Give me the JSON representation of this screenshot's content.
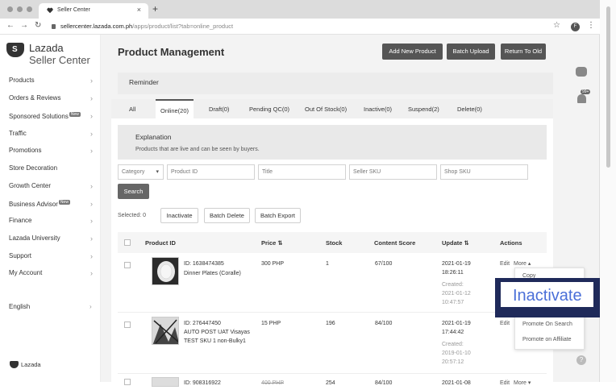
{
  "browser": {
    "tab_title": "Seller Center",
    "tab_close": "×",
    "new_tab": "+",
    "back": "←",
    "forward": "→",
    "reload": "↻",
    "url_host": "sellercenter.lazada.com.ph",
    "url_path": "/apps/product/list?tab=online_product",
    "star": "☆",
    "profile": "F",
    "menu": "⋮"
  },
  "sidebar": {
    "brand": "Lazada",
    "subtitle": "Seller Center",
    "items": [
      {
        "label": "Products",
        "chevron": "›"
      },
      {
        "label": "Orders & Reviews",
        "chevron": "›"
      },
      {
        "label": "Sponsored Solutions",
        "badge": "New",
        "chevron": "›"
      },
      {
        "label": "Traffic",
        "chevron": "›"
      },
      {
        "label": "Promotions",
        "chevron": "›"
      },
      {
        "label": "Store Decoration",
        "chevron": ""
      },
      {
        "label": "Growth Center",
        "chevron": "›"
      },
      {
        "label": "Business Advisor",
        "badge": "New",
        "chevron": "›"
      },
      {
        "label": "Finance",
        "chevron": "›"
      },
      {
        "label": "Lazada University",
        "chevron": "›"
      },
      {
        "label": "Support",
        "chevron": "›"
      },
      {
        "label": "My Account",
        "chevron": "›"
      }
    ],
    "language": "English",
    "language_chevron": "›",
    "footer_brand": "Lazada"
  },
  "header": {
    "title": "Product Management",
    "add_new": "Add New Product",
    "batch_upload": "Batch Upload",
    "return_old": "Return To Old"
  },
  "reminder": "Reminder",
  "tabs": [
    {
      "label": "All"
    },
    {
      "label": "Online(20)"
    },
    {
      "label": "Draft(0)"
    },
    {
      "label": "Pending QC(0)"
    },
    {
      "label": "Out Of Stock(0)"
    },
    {
      "label": "Inactive(0)"
    },
    {
      "label": "Suspend(2)"
    },
    {
      "label": "Delete(0)"
    }
  ],
  "explanation": {
    "heading": "Explanation",
    "text": "Products that are live and can be seen by buyers."
  },
  "filters": {
    "category": "Category",
    "category_arrow": "▾",
    "product_id": "Product ID",
    "title": "Title",
    "seller_sku": "Seller SKU",
    "shop_sku": "Shop SKU",
    "search": "Search"
  },
  "toolbar": {
    "selected": "Selected: 0",
    "inactivate": "Inactivate",
    "batch_delete": "Batch Delete",
    "batch_export": "Batch Export"
  },
  "table": {
    "headers": {
      "product_id": "Product ID",
      "price": "Price ⇅",
      "stock": "Stock",
      "content_score": "Content Score",
      "update": "Update ⇅",
      "actions": "Actions"
    },
    "rows": [
      {
        "id": "ID: 1638474385",
        "name": "Dinner Plates (Coralle)",
        "price": "300 PHP",
        "stock": "1",
        "score": "67/100",
        "updated_date": "2021-01-19",
        "updated_time": "18:26:11",
        "created_label": "Created:",
        "created_date": "2021-01-12",
        "created_time": "10:47:57",
        "edit": "Edit",
        "more": "More ▴"
      },
      {
        "id": "ID: 276447450",
        "name": "AUTO POST UAT Visayas TEST SKU 1 non-Bulky1",
        "price": "15 PHP",
        "stock": "196",
        "score": "84/100",
        "updated_date": "2021-01-19",
        "updated_time": "17:44:42",
        "created_label": "Created:",
        "created_date": "2019-01-10",
        "created_time": "20:57:12",
        "edit": "Edit",
        "more": ""
      },
      {
        "id": "ID: 908316922",
        "name": "",
        "price": "400 PHP",
        "stock": "254",
        "score": "84/100",
        "updated_date": "2021-01-08",
        "updated_time": "",
        "created_label": "",
        "created_date": "",
        "created_time": "",
        "edit": "Edit",
        "more": "More ▾"
      }
    ]
  },
  "more_menu": {
    "items": [
      "Copy",
      "Promote On Search",
      "Promote on Affiliate"
    ],
    "highlighted": "Inactivate"
  },
  "floating": {
    "notif_badge": "99+",
    "help": "?"
  }
}
